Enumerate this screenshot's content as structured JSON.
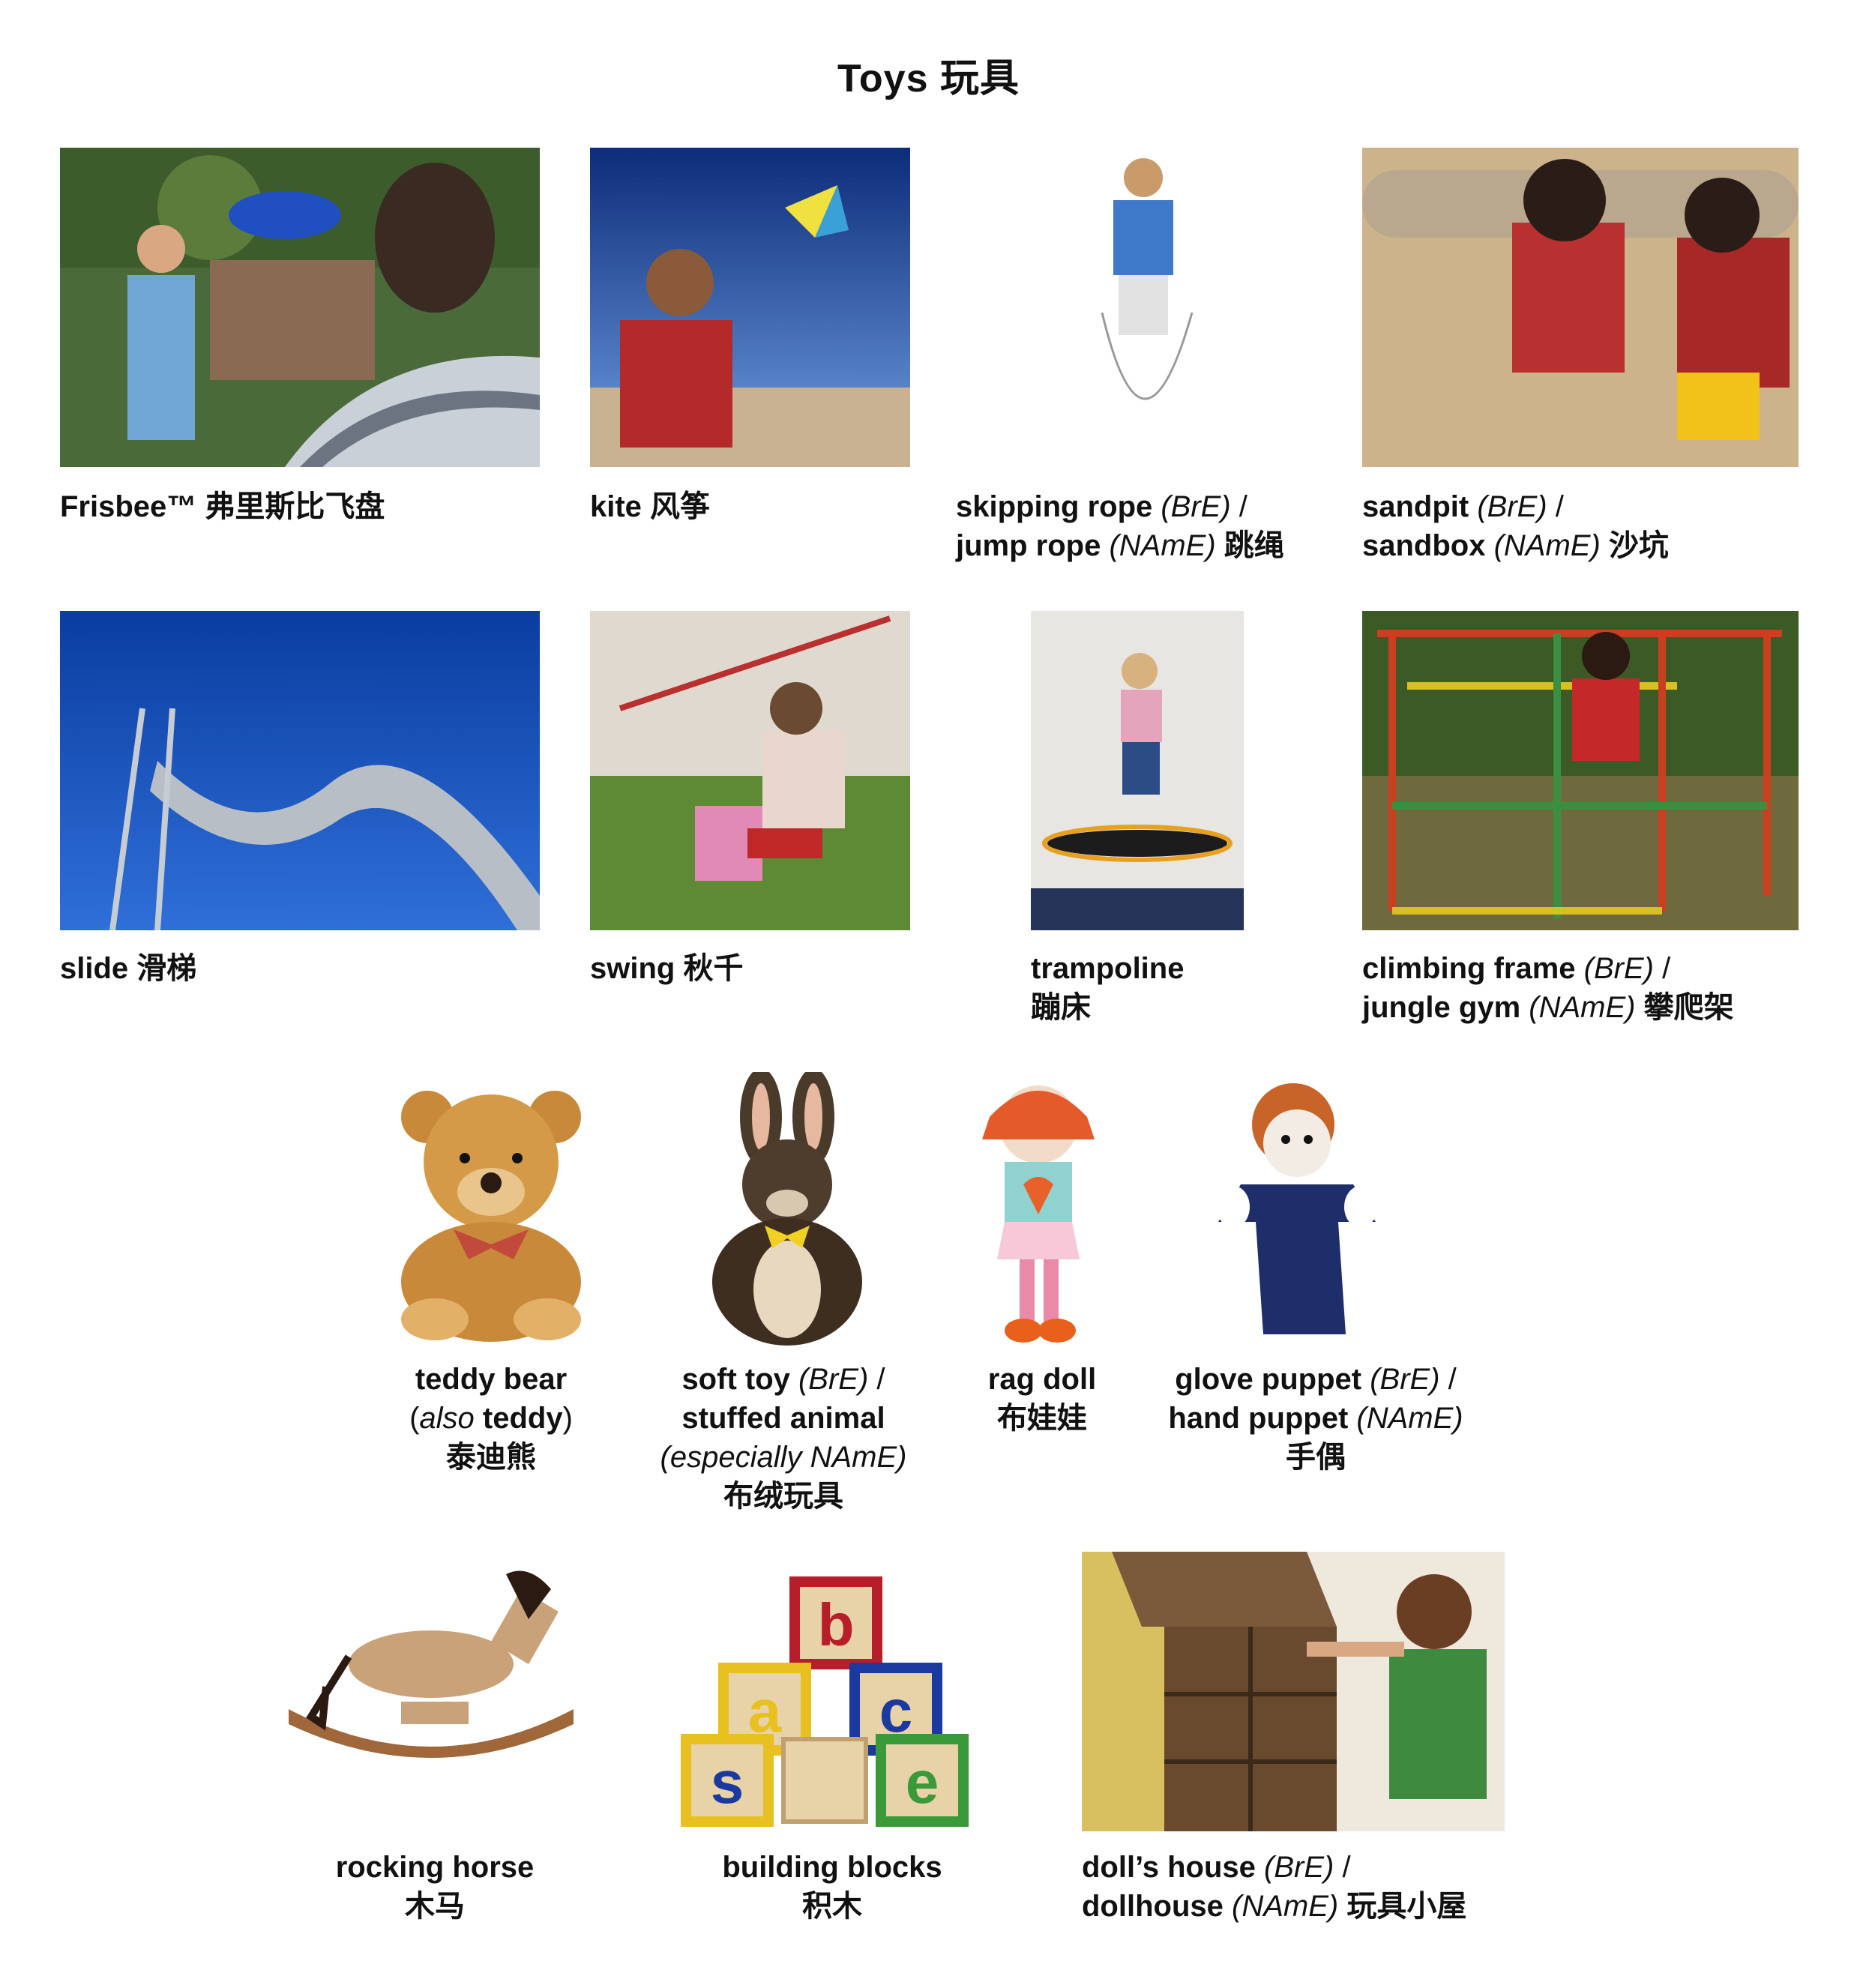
{
  "title": "Toys  玩具",
  "items": [
    {
      "id": "frisbee",
      "lines": [
        [
          {
            "t": "Frisbee™  弗里斯比飞盘",
            "s": "b"
          }
        ]
      ]
    },
    {
      "id": "kite",
      "lines": [
        [
          {
            "t": "kite  风筝",
            "s": "b"
          }
        ]
      ]
    },
    {
      "id": "skipping-rope",
      "lines": [
        [
          {
            "t": "skipping rope ",
            "s": "b"
          },
          {
            "t": "(BrE)",
            "s": "i"
          },
          {
            "t": " /",
            "s": "n"
          }
        ],
        [
          {
            "t": "jump rope ",
            "s": "b"
          },
          {
            "t": "(NAmE)",
            "s": "i"
          },
          {
            "t": "  跳绳",
            "s": "b"
          }
        ]
      ]
    },
    {
      "id": "sandpit",
      "lines": [
        [
          {
            "t": "sandpit ",
            "s": "b"
          },
          {
            "t": "(BrE)",
            "s": "i"
          },
          {
            "t": " /",
            "s": "n"
          }
        ],
        [
          {
            "t": "sandbox ",
            "s": "b"
          },
          {
            "t": "(NAmE)",
            "s": "i"
          },
          {
            "t": "  沙坑",
            "s": "b"
          }
        ]
      ]
    },
    {
      "id": "slide",
      "lines": [
        [
          {
            "t": "slide  滑梯",
            "s": "b"
          }
        ]
      ]
    },
    {
      "id": "swing",
      "lines": [
        [
          {
            "t": "swing  秋千",
            "s": "b"
          }
        ]
      ]
    },
    {
      "id": "trampoline",
      "lines": [
        [
          {
            "t": "trampoline",
            "s": "b"
          }
        ],
        [
          {
            "t": "蹦床",
            "s": "b"
          }
        ]
      ]
    },
    {
      "id": "climbing-frame",
      "lines": [
        [
          {
            "t": "climbing frame ",
            "s": "b"
          },
          {
            "t": "(BrE)",
            "s": "i"
          },
          {
            "t": " /",
            "s": "n"
          }
        ],
        [
          {
            "t": "jungle gym ",
            "s": "b"
          },
          {
            "t": "(NAmE)",
            "s": "i"
          },
          {
            "t": "  攀爬架",
            "s": "b"
          }
        ]
      ]
    },
    {
      "id": "teddy-bear",
      "lines": [
        [
          {
            "t": "teddy bear",
            "s": "b"
          }
        ],
        [
          {
            "t": "(",
            "s": "n"
          },
          {
            "t": "also",
            "s": "i"
          },
          {
            "t": " teddy",
            "s": "b"
          },
          {
            "t": ")",
            "s": "n"
          }
        ],
        [
          {
            "t": "泰迪熊",
            "s": "b"
          }
        ]
      ]
    },
    {
      "id": "soft-toy",
      "lines": [
        [
          {
            "t": "soft toy ",
            "s": "b"
          },
          {
            "t": "(BrE)",
            "s": "i"
          },
          {
            "t": " /",
            "s": "n"
          }
        ],
        [
          {
            "t": "stuffed animal",
            "s": "b"
          }
        ],
        [
          {
            "t": "(especially NAmE)",
            "s": "i"
          }
        ],
        [
          {
            "t": "布绒玩具",
            "s": "b"
          }
        ]
      ]
    },
    {
      "id": "rag-doll",
      "lines": [
        [
          {
            "t": "rag doll",
            "s": "b"
          }
        ],
        [
          {
            "t": "布娃娃",
            "s": "b"
          }
        ]
      ]
    },
    {
      "id": "glove-puppet",
      "lines": [
        [
          {
            "t": "glove puppet ",
            "s": "b"
          },
          {
            "t": "(BrE)",
            "s": "i"
          },
          {
            "t": " /",
            "s": "n"
          }
        ],
        [
          {
            "t": "hand puppet ",
            "s": "b"
          },
          {
            "t": "(NAmE)",
            "s": "i"
          }
        ],
        [
          {
            "t": "手偶",
            "s": "b"
          }
        ]
      ]
    },
    {
      "id": "rocking-horse",
      "lines": [
        [
          {
            "t": "rocking horse",
            "s": "b"
          }
        ],
        [
          {
            "t": "木马",
            "s": "b"
          }
        ]
      ]
    },
    {
      "id": "building-blocks",
      "lines": [
        [
          {
            "t": "building blocks",
            "s": "b"
          }
        ],
        [
          {
            "t": "积木",
            "s": "b"
          }
        ]
      ]
    },
    {
      "id": "dolls-house",
      "lines": [
        [
          {
            "t": "doll’s house ",
            "s": "b"
          },
          {
            "t": "(BrE)",
            "s": "i"
          },
          {
            "t": " /",
            "s": "n"
          }
        ],
        [
          {
            "t": "dollhouse ",
            "s": "b"
          },
          {
            "t": "(NAmE)",
            "s": "i"
          },
          {
            "t": "  玩具小屋",
            "s": "b"
          }
        ]
      ]
    }
  ],
  "blocks": [
    "b",
    "a",
    "c",
    "s",
    "e"
  ]
}
